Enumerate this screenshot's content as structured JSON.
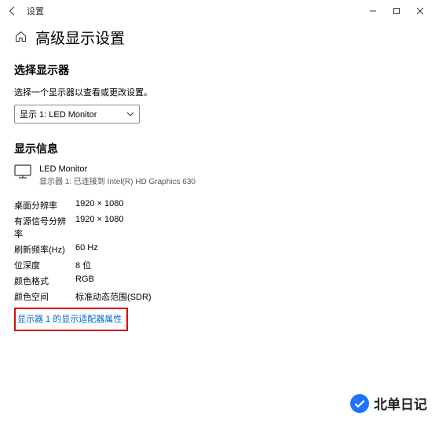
{
  "window": {
    "title": "设置"
  },
  "page": {
    "heading": "高级显示设置"
  },
  "select_display": {
    "title": "选择显示器",
    "help": "选择一个显示器以查看或更改设置。",
    "selected": "显示 1: LED Monitor"
  },
  "display_info": {
    "title": "显示信息",
    "monitor_name": "LED Monitor",
    "monitor_sub": "显示器 1: 已连接到 Intel(R) HD Graphics 630",
    "rows": [
      {
        "label": "桌面分辨率",
        "value": "1920 × 1080"
      },
      {
        "label": "有源信号分辨率",
        "value": "1920 × 1080"
      },
      {
        "label": "刷新频率(Hz)",
        "value": "60 Hz"
      },
      {
        "label": "位深度",
        "value": "8 位"
      },
      {
        "label": "颜色格式",
        "value": "RGB"
      },
      {
        "label": "颜色空间",
        "value": "标准动态范围(SDR)"
      }
    ],
    "adapter_link": "显示器 1 的显示适配器属性"
  },
  "watermark": {
    "text": "北单日记"
  }
}
